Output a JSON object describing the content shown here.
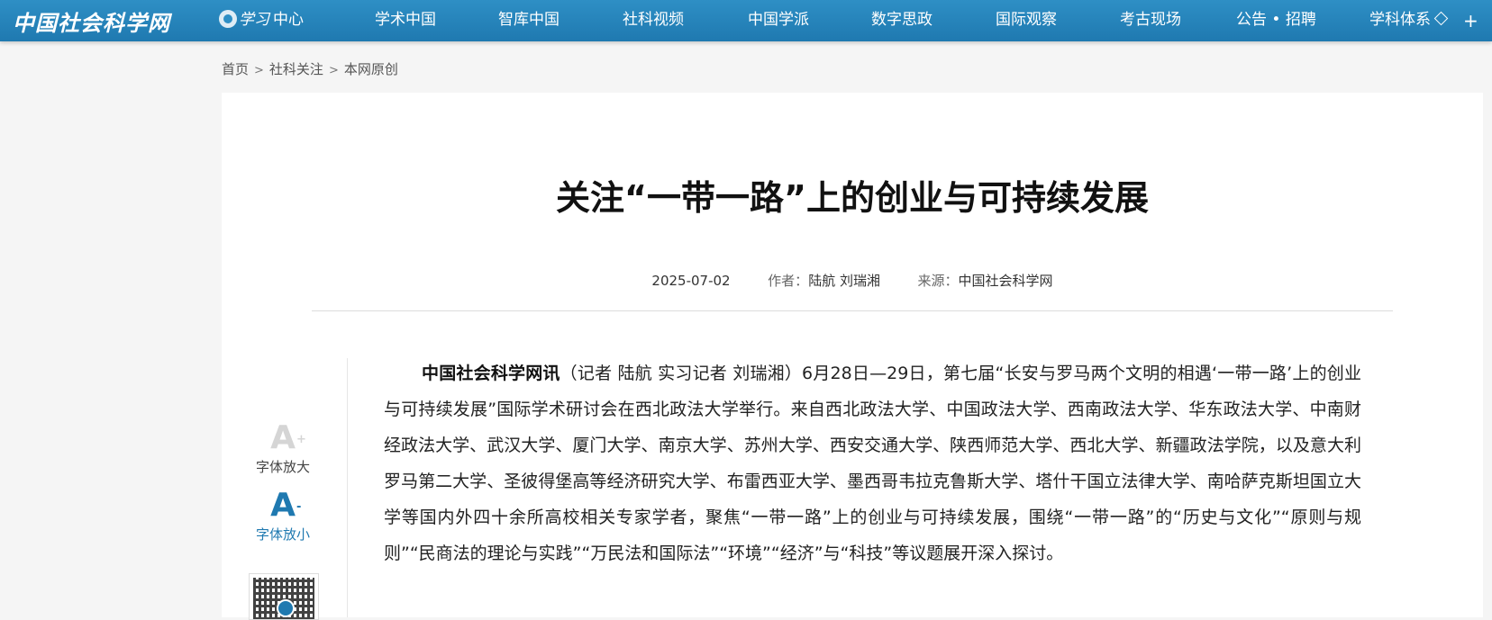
{
  "logo": "中国社会科学网",
  "nav": {
    "study_center": {
      "script": "学习",
      "label": "中心"
    },
    "items": [
      "学术中国",
      "智库中国",
      "社科视频",
      "中国学派",
      "数字思政",
      "国际观察",
      "考古现场",
      "公告 • 招聘",
      "学科体系"
    ],
    "more": "+"
  },
  "breadcrumb": {
    "items": [
      "首页",
      "社科关注",
      "本网原创"
    ],
    "separator": ">"
  },
  "article": {
    "title": "关注“一带一路”上的创业与可持续发展",
    "date": "2025-07-02",
    "author_label": "作者：",
    "author": "陆航 刘瑞湘",
    "source_label": "来源：",
    "source": "中国社会科学网",
    "lead_bold": "中国社会科学网讯",
    "body": "（记者 陆航 实习记者 刘瑞湘）6月28日—29日，第七届“长安与罗马两个文明的相遇‘一带一路’上的创业与可持续发展”国际学术研讨会在西北政法大学举行。来自西北政法大学、中国政法大学、西南政法大学、华东政法大学、中南财经政法大学、武汉大学、厦门大学、南京大学、苏州大学、西安交通大学、陕西师范大学、西北大学、新疆政法学院，以及意大利罗马第二大学、圣彼得堡高等经济研究大学、布雷西亚大学、墨西哥韦拉克鲁斯大学、塔什干国立法律大学、南哈萨克斯坦国立大学等国内外四十余所高校相关专家学者，聚焦“一带一路”上的创业与可持续发展，围绕“一带一路”的“历史与文化”“原则与规则”“民商法的理论与实践”“万民法和国际法”“环境”“经济”与“科技”等议题展开深入探讨。"
  },
  "tools": {
    "enlarge": {
      "glyph": "A",
      "sign": "+",
      "label": "字体放大"
    },
    "shrink": {
      "glyph": "A",
      "sign": "-",
      "label": "字体放小"
    }
  },
  "colors": {
    "nav_bg": "#2e8fc5",
    "accent": "#1f79b0",
    "page_bg": "#f5f5f5"
  }
}
